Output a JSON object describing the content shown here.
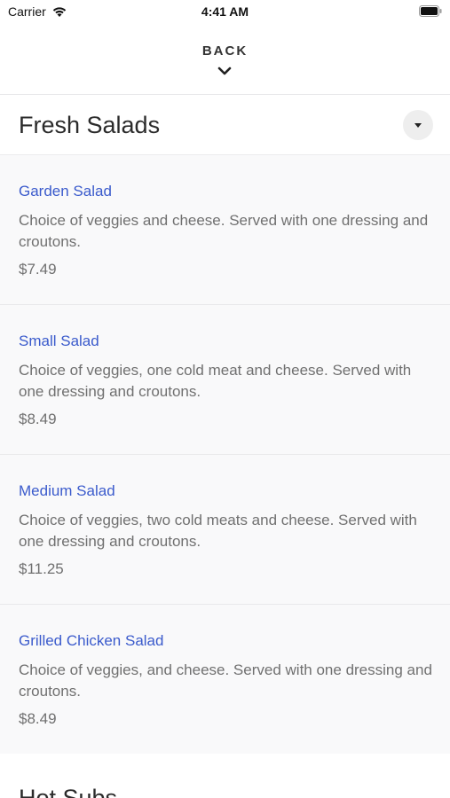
{
  "status_bar": {
    "carrier": "Carrier",
    "time": "4:41 AM"
  },
  "header": {
    "back_label": "BACK"
  },
  "section": {
    "title": "Fresh Salads"
  },
  "items": [
    {
      "name": "Garden Salad",
      "description": "Choice of veggies and cheese. Served with one dressing and croutons.",
      "price": "$7.49"
    },
    {
      "name": "Small Salad",
      "description": "Choice of veggies, one cold meat and cheese. Served with one dressing and croutons.",
      "price": "$8.49"
    },
    {
      "name": "Medium Salad",
      "description": "Choice of veggies, two cold meats and cheese. Served with one dressing and croutons.",
      "price": "$11.25"
    },
    {
      "name": "Grilled Chicken Salad",
      "description": "Choice of veggies, and cheese. Served with one dressing and croutons.",
      "price": "$8.49"
    }
  ],
  "next_section": {
    "title": "Hot Subs"
  },
  "colors": {
    "item_name": "#3b5bcc",
    "text_secondary": "#707070",
    "background": "#f9f9fa"
  }
}
